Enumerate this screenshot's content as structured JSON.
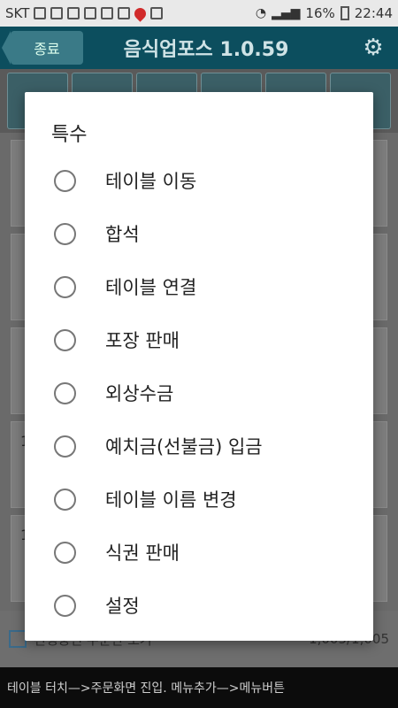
{
  "statusbar": {
    "carrier": "SKT",
    "battery": "16%",
    "time": "22:44"
  },
  "appbar": {
    "back_label": "종료",
    "title": "음식업포스 1.0.59"
  },
  "background": {
    "table_numbers": [
      "1",
      "1"
    ],
    "show_checkbox_label": "진행중인 주문만 보기",
    "order_count": "1,005/1,005",
    "hint": "테이블 터치—>주문화면 진입. 메뉴추가—>메뉴버튼"
  },
  "dialog": {
    "title": "특수",
    "options": [
      "테이블 이동",
      "합석",
      "테이블 연결",
      "포장 판매",
      "외상수금",
      "예치금(선불금) 입금",
      "테이블 이름 변경",
      "식권 판매",
      "설정"
    ]
  }
}
